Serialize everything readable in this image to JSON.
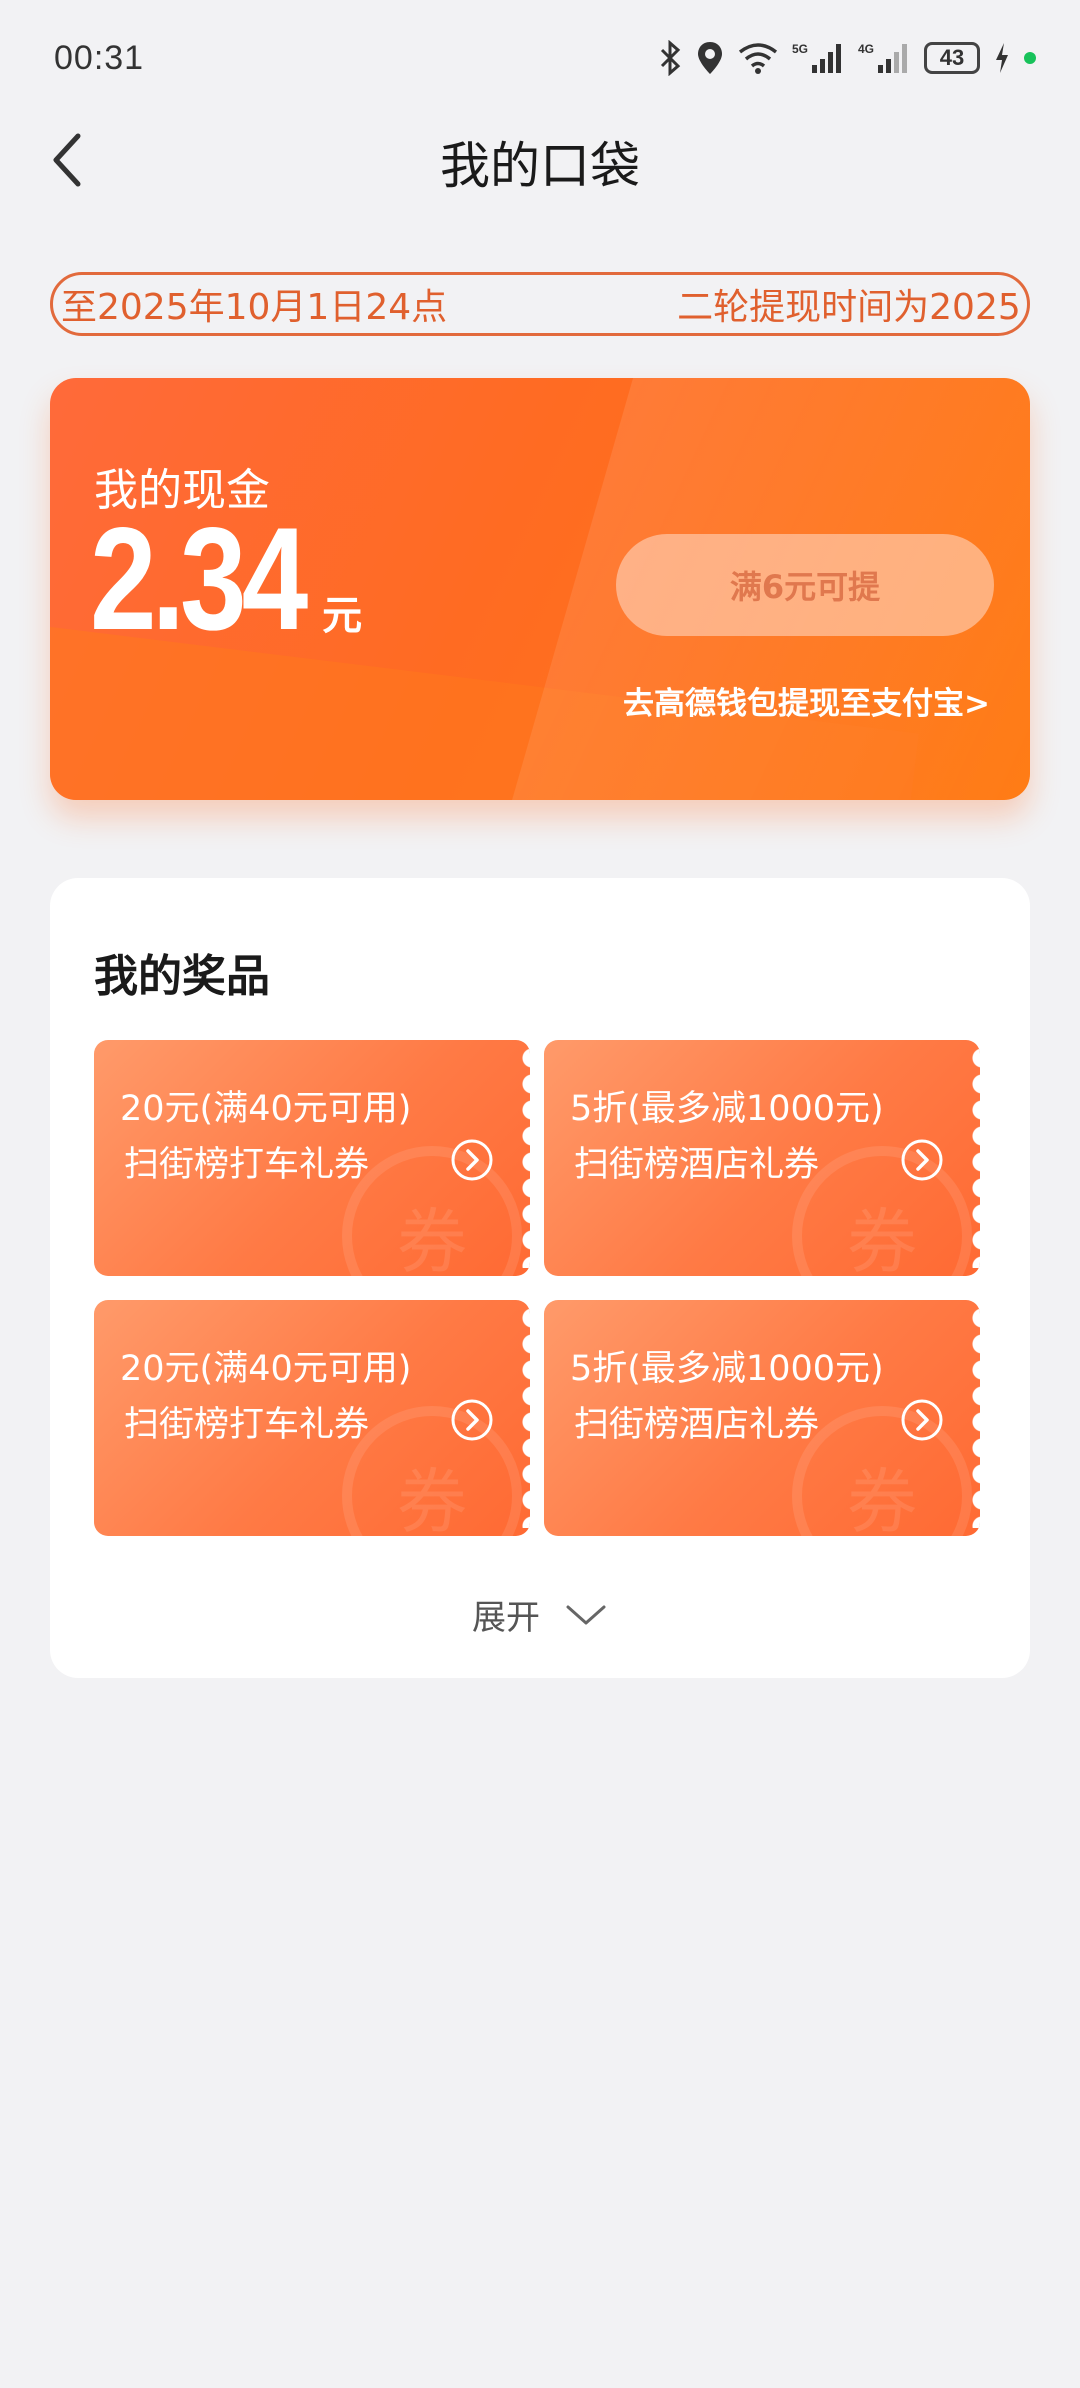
{
  "status_bar": {
    "time": "00:31",
    "icons": [
      "bluetooth-icon",
      "location-icon",
      "wifi-icon",
      "signal-5g-icon",
      "signal-4g-icon",
      "battery-icon",
      "charging-icon"
    ],
    "battery_level": "43",
    "dot_color": "#18c25a"
  },
  "nav": {
    "title": "我的口袋"
  },
  "notice": {
    "text_left": "至2025年10月1日24点",
    "text_right": "二轮提现时间为2025"
  },
  "cash": {
    "label": "我的现金",
    "amount": "2.34",
    "unit": "元",
    "withdraw_button": "满6元可提",
    "wallet_link": "去高德钱包提现至支付宝>"
  },
  "prizes": {
    "title": "我的奖品",
    "coupons": [
      {
        "line1": "20元(满40元可用)",
        "line2": "扫街榜打车礼券",
        "watermark": "券"
      },
      {
        "line1": "5折(最多减1000元)",
        "line2": "扫街榜酒店礼券",
        "watermark": "券"
      },
      {
        "line1": "20元(满40元可用)",
        "line2": "扫街榜打车礼券",
        "watermark": "券"
      },
      {
        "line1": "5折(最多减1000元)",
        "line2": "扫街榜酒店礼券",
        "watermark": "券"
      }
    ],
    "expand_label": "展开"
  },
  "colors": {
    "accent": "#ff6b22",
    "coupon": "#ff7a45",
    "background": "#f2f2f4"
  }
}
